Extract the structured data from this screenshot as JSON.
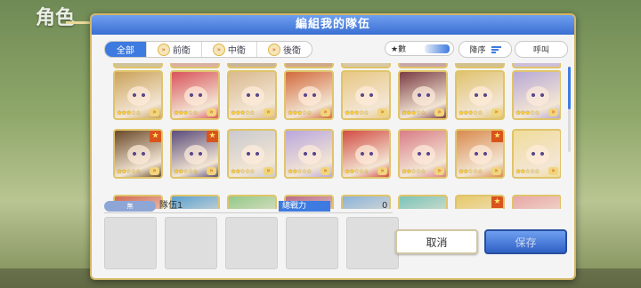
{
  "background": {
    "title": "角色"
  },
  "dialog": {
    "title": "編組我的隊伍",
    "tabs": [
      {
        "label": "全部",
        "active": true
      },
      {
        "label": "前衛",
        "active": false
      },
      {
        "label": "中衛",
        "active": false
      },
      {
        "label": "後衛",
        "active": false
      }
    ],
    "sort_label": "★數",
    "order_label": "降序",
    "call_label": "呼叫",
    "roster_rows": [
      [
        {
          "color": "#caa25a",
          "stars": "★★★☆☆"
        },
        {
          "color": "#d9535b",
          "stars": "★★★☆☆"
        },
        {
          "color": "#d9b98f",
          "stars": "★★★☆☆"
        },
        {
          "color": "#d26a3c",
          "stars": "★★★☆☆"
        },
        {
          "color": "#e8c783",
          "stars": "★★★☆☆"
        },
        {
          "color": "#7a3b43",
          "stars": "★★★☆☆"
        },
        {
          "color": "#e0c36f",
          "stars": "★★★☆☆"
        },
        {
          "color": "#b8a9d6",
          "stars": "★★★☆☆"
        }
      ],
      [
        {
          "color": "#6b4a2a",
          "stars": "★★☆☆☆",
          "flag": true
        },
        {
          "color": "#5a4c7a",
          "stars": "★★☆☆☆",
          "flag": true
        },
        {
          "color": "#c9c9cf",
          "stars": "★★☆☆☆"
        },
        {
          "color": "#b9a6dd",
          "stars": "★★☆☆☆"
        },
        {
          "color": "#d24c43",
          "stars": "★★☆☆☆"
        },
        {
          "color": "#d97d86",
          "stars": "★★☆☆☆"
        },
        {
          "color": "#d98a4e",
          "stars": "★★☆☆☆",
          "flag": true
        },
        {
          "color": "#f0dc9a",
          "stars": "★★☆☆☆"
        }
      ],
      [
        {
          "color": "#d26a55",
          "stars": ""
        },
        {
          "color": "#5aa0d2",
          "stars": ""
        },
        {
          "color": "#93c98a",
          "stars": ""
        },
        {
          "color": "#b86a8a",
          "stars": ""
        },
        {
          "color": "#8ab3d9",
          "stars": ""
        },
        {
          "color": "#7ac4b9",
          "stars": ""
        },
        {
          "color": "#e6c96a",
          "stars": "",
          "flag": true
        },
        {
          "color": "#e8a8a8",
          "stars": ""
        }
      ]
    ],
    "team": {
      "badge": "無",
      "name": "隊伍1",
      "power_label": "總戰力",
      "power_value": "0",
      "slots": 5
    },
    "cancel_label": "取消",
    "save_label": "保存"
  }
}
